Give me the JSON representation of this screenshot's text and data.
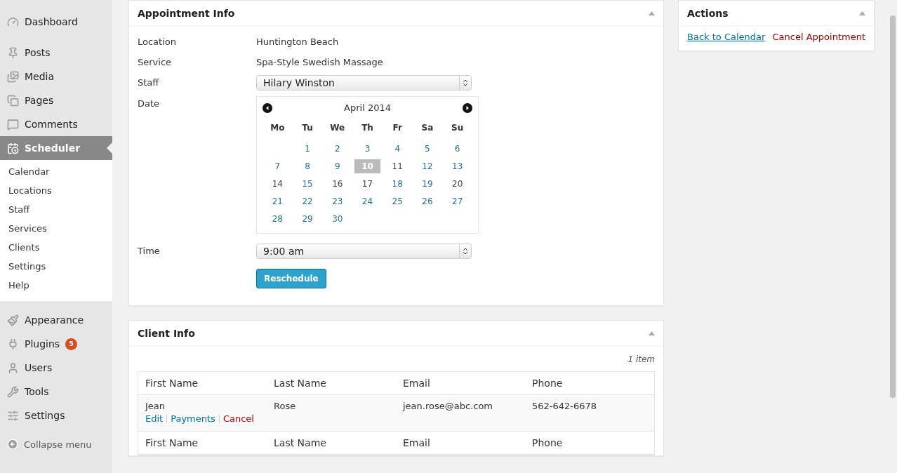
{
  "sidebar": {
    "items": [
      {
        "label": "Dashboard",
        "selected": false
      },
      {
        "label": "Posts",
        "selected": false
      },
      {
        "label": "Media",
        "selected": false
      },
      {
        "label": "Pages",
        "selected": false
      },
      {
        "label": "Comments",
        "selected": false
      },
      {
        "label": "Scheduler",
        "selected": true,
        "children": [
          {
            "label": "Calendar"
          },
          {
            "label": "Locations"
          },
          {
            "label": "Staff"
          },
          {
            "label": "Services"
          },
          {
            "label": "Clients"
          },
          {
            "label": "Settings"
          },
          {
            "label": "Help"
          }
        ]
      },
      {
        "label": "Appearance",
        "selected": false
      },
      {
        "label": "Plugins",
        "selected": false,
        "badge": "5"
      },
      {
        "label": "Users",
        "selected": false
      },
      {
        "label": "Tools",
        "selected": false
      },
      {
        "label": "Settings",
        "selected": false
      }
    ],
    "collapse": "Collapse menu"
  },
  "appointment_info": {
    "title": "Appointment Info",
    "location": {
      "label": "Location",
      "value": "Huntington Beach"
    },
    "service": {
      "label": "Service",
      "value": "Spa-Style Swedish Massage"
    },
    "staff": {
      "label": "Staff",
      "value": "Hilary Winston"
    },
    "date": {
      "label": "Date",
      "month": "April 2014",
      "weekdays": [
        "Mo",
        "Tu",
        "We",
        "Th",
        "Fr",
        "Sa",
        "Su"
      ],
      "weeks": [
        [
          {
            "day": "1",
            "available": true,
            "selected": false
          },
          {
            "day": "2",
            "available": true,
            "selected": false
          },
          {
            "day": "3",
            "available": true,
            "selected": false
          },
          {
            "day": "4",
            "available": true,
            "selected": false
          },
          {
            "day": "5",
            "available": true,
            "selected": false
          },
          {
            "day": "6",
            "available": true,
            "selected": false
          }
        ],
        [
          {
            "day": "7",
            "available": true,
            "selected": false
          },
          {
            "day": "8",
            "available": true,
            "selected": false
          },
          {
            "day": "9",
            "available": true,
            "selected": false
          },
          {
            "day": "10",
            "available": true,
            "selected": true
          },
          {
            "day": "11",
            "available": false,
            "selected": false
          },
          {
            "day": "12",
            "available": true,
            "selected": false
          },
          {
            "day": "13",
            "available": true,
            "selected": false
          }
        ],
        [
          {
            "day": "14",
            "available": false,
            "selected": false
          },
          {
            "day": "15",
            "available": true,
            "selected": false
          },
          {
            "day": "16",
            "available": false,
            "selected": false
          },
          {
            "day": "17",
            "available": false,
            "selected": false
          },
          {
            "day": "18",
            "available": true,
            "selected": false
          },
          {
            "day": "19",
            "available": true,
            "selected": false
          },
          {
            "day": "20",
            "available": false,
            "selected": false
          }
        ],
        [
          {
            "day": "21",
            "available": true,
            "selected": false
          },
          {
            "day": "22",
            "available": true,
            "selected": false
          },
          {
            "day": "23",
            "available": true,
            "selected": false
          },
          {
            "day": "24",
            "available": true,
            "selected": false
          },
          {
            "day": "25",
            "available": true,
            "selected": false
          },
          {
            "day": "26",
            "available": true,
            "selected": false
          },
          {
            "day": "27",
            "available": true,
            "selected": false
          }
        ],
        [
          {
            "day": "28",
            "available": true,
            "selected": false
          },
          {
            "day": "29",
            "available": true,
            "selected": false
          },
          {
            "day": "30",
            "available": true,
            "selected": false
          }
        ]
      ]
    },
    "time": {
      "label": "Time",
      "value": "9:00 am"
    },
    "button": "Reschedule"
  },
  "client_info": {
    "title": "Client Info",
    "count": "1 item",
    "columns": [
      "First Name",
      "Last Name",
      "Email",
      "Phone"
    ],
    "rows": [
      {
        "cells": [
          "Jean",
          "Rose",
          "jean.rose@abc.com",
          "562-642-6678"
        ],
        "actions": [
          {
            "label": "Edit",
            "kind": "link"
          },
          {
            "label": "Payments",
            "kind": "link"
          },
          {
            "label": "Cancel",
            "kind": "danger"
          }
        ]
      }
    ],
    "footer_columns": [
      "First Name",
      "Last Name",
      "Email",
      "Phone"
    ]
  },
  "actions": {
    "title": "Actions",
    "links": [
      {
        "label": "Back to Calendar",
        "kind": "link"
      },
      {
        "label": "Cancel Appointment",
        "kind": "danger"
      }
    ]
  }
}
